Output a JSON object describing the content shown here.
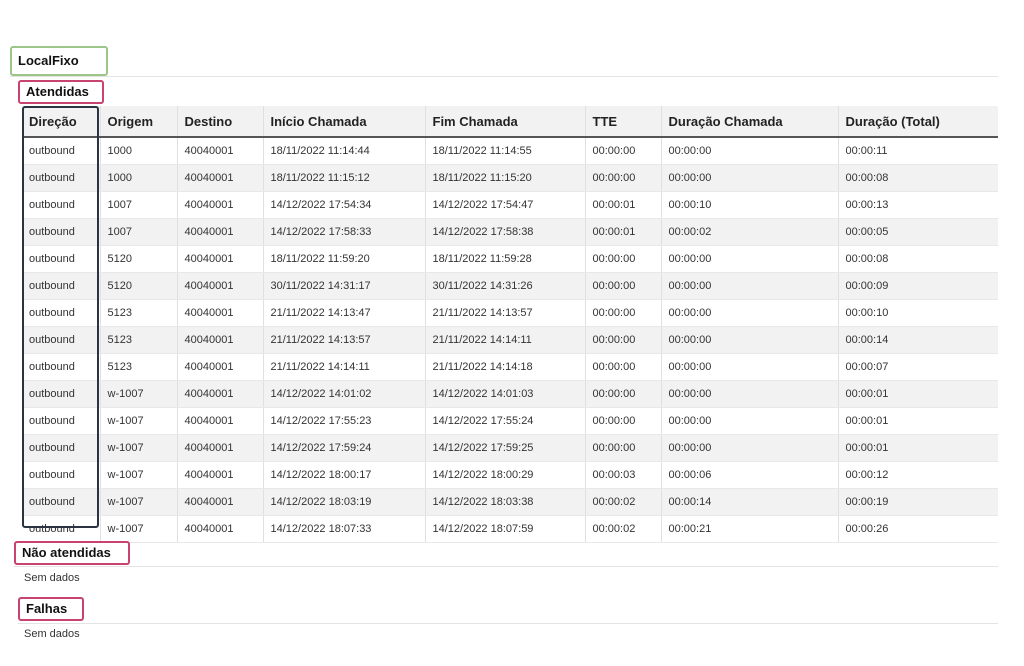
{
  "report": {
    "title": "LocalFixo",
    "atendidas": {
      "heading": "Atendidas",
      "columns": [
        "Direção",
        "Origem",
        "Destino",
        "Início Chamada",
        "Fim Chamada",
        "TTE",
        "Duração Chamada",
        "Duração (Total)"
      ],
      "rows": [
        [
          "outbound",
          "1000",
          "40040001",
          "18/11/2022 11:14:44",
          "18/11/2022 11:14:55",
          "00:00:00",
          "00:00:00",
          "00:00:11"
        ],
        [
          "outbound",
          "1000",
          "40040001",
          "18/11/2022 11:15:12",
          "18/11/2022 11:15:20",
          "00:00:00",
          "00:00:00",
          "00:00:08"
        ],
        [
          "outbound",
          "1007",
          "40040001",
          "14/12/2022 17:54:34",
          "14/12/2022 17:54:47",
          "00:00:01",
          "00:00:10",
          "00:00:13"
        ],
        [
          "outbound",
          "1007",
          "40040001",
          "14/12/2022 17:58:33",
          "14/12/2022 17:58:38",
          "00:00:01",
          "00:00:02",
          "00:00:05"
        ],
        [
          "outbound",
          "5120",
          "40040001",
          "18/11/2022 11:59:20",
          "18/11/2022 11:59:28",
          "00:00:00",
          "00:00:00",
          "00:00:08"
        ],
        [
          "outbound",
          "5120",
          "40040001",
          "30/11/2022 14:31:17",
          "30/11/2022 14:31:26",
          "00:00:00",
          "00:00:00",
          "00:00:09"
        ],
        [
          "outbound",
          "5123",
          "40040001",
          "21/11/2022 14:13:47",
          "21/11/2022 14:13:57",
          "00:00:00",
          "00:00:00",
          "00:00:10"
        ],
        [
          "outbound",
          "5123",
          "40040001",
          "21/11/2022 14:13:57",
          "21/11/2022 14:14:11",
          "00:00:00",
          "00:00:00",
          "00:00:14"
        ],
        [
          "outbound",
          "5123",
          "40040001",
          "21/11/2022 14:14:11",
          "21/11/2022 14:14:18",
          "00:00:00",
          "00:00:00",
          "00:00:07"
        ],
        [
          "outbound",
          "w-1007",
          "40040001",
          "14/12/2022 14:01:02",
          "14/12/2022 14:01:03",
          "00:00:00",
          "00:00:00",
          "00:00:01"
        ],
        [
          "outbound",
          "w-1007",
          "40040001",
          "14/12/2022 17:55:23",
          "14/12/2022 17:55:24",
          "00:00:00",
          "00:00:00",
          "00:00:01"
        ],
        [
          "outbound",
          "w-1007",
          "40040001",
          "14/12/2022 17:59:24",
          "14/12/2022 17:59:25",
          "00:00:00",
          "00:00:00",
          "00:00:01"
        ],
        [
          "outbound",
          "w-1007",
          "40040001",
          "14/12/2022 18:00:17",
          "14/12/2022 18:00:29",
          "00:00:03",
          "00:00:06",
          "00:00:12"
        ],
        [
          "outbound",
          "w-1007",
          "40040001",
          "14/12/2022 18:03:19",
          "14/12/2022 18:03:38",
          "00:00:02",
          "00:00:14",
          "00:00:19"
        ],
        [
          "outbound",
          "w-1007",
          "40040001",
          "14/12/2022 18:07:33",
          "14/12/2022 18:07:59",
          "00:00:02",
          "00:00:21",
          "00:00:26"
        ]
      ]
    },
    "nao_atendidas": {
      "heading": "Não atendidas",
      "empty_text": "Sem dados"
    },
    "falhas": {
      "heading": "Falhas",
      "empty_text": "Sem dados"
    }
  },
  "colors": {
    "title_border": "#9cc58a",
    "section_border": "#c8436d",
    "column_highlight": "#2a3442",
    "row_stripe": "#f2f2f2"
  }
}
